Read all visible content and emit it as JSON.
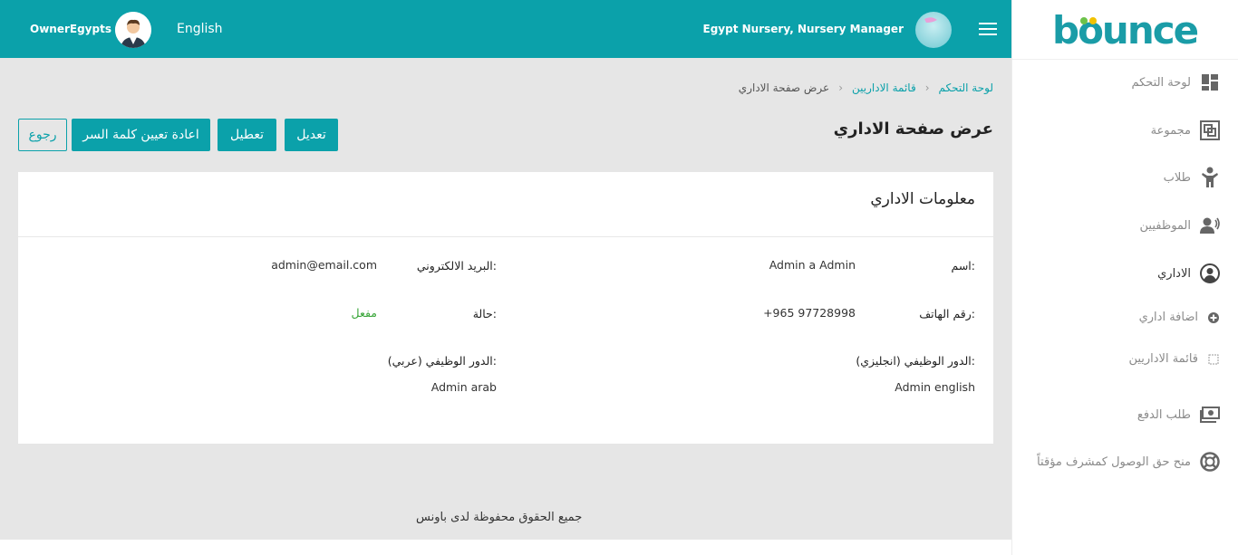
{
  "header": {
    "owner_name": "OwnerEgypts",
    "language": "English",
    "nursery_label": "Egypt Nursery, Nursery Manager"
  },
  "sidebar": {
    "logo": "bounce",
    "items": [
      {
        "label": "لوحة التحكم",
        "icon": "dashboard-icon"
      },
      {
        "label": "مجموعة",
        "icon": "group-icon"
      },
      {
        "label": "طلاب",
        "icon": "student-icon"
      },
      {
        "label": "الموظفيين",
        "icon": "staff-icon"
      },
      {
        "label": "الاداري",
        "icon": "admin-icon"
      },
      {
        "label": "اضافة اداري",
        "icon": "plus-circle-icon"
      },
      {
        "label": "قائمة الاداريين",
        "icon": "square-icon"
      },
      {
        "label": "طلب الدفع",
        "icon": "payment-icon"
      },
      {
        "label": "منح حق الوصول كمشرف مؤقتاً",
        "icon": "lifebuoy-icon"
      }
    ]
  },
  "breadcrumb": {
    "items": [
      "لوحة التحكم",
      "قائمة الاداريين",
      "عرض صفحة الاداري"
    ]
  },
  "page": {
    "title": "عرض صفحة الاداري",
    "buttons": {
      "edit": "تعديل",
      "disable": "تعطيل",
      "reset_password": "اعادة تعيين كلمة السر",
      "back": "رجوع"
    }
  },
  "card": {
    "title": "معلومات الاداري",
    "fields": {
      "name_label": "اسم:",
      "name_value": "Admin a Admin",
      "email_label": "البريد الالكتروني:",
      "email_value": "admin@email.com",
      "phone_label": "رقم الهاتف:",
      "phone_value": "+965 97728998",
      "status_label": "حالة:",
      "status_value": "مفعل",
      "role_en_label": "الدور الوظيفي (انجليزي):",
      "role_en_value": "Admin english",
      "role_ar_label": "الدور الوظيفي (عربي):",
      "role_ar_value": "Admin arab"
    }
  },
  "footer": {
    "text": "جميع الحقوق محفوظة لدى باونس"
  },
  "colors": {
    "primary": "#0ba1aa",
    "status_active": "#3aa63a"
  }
}
